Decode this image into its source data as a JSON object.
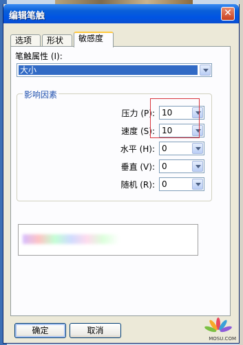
{
  "window": {
    "title": "编辑笔触"
  },
  "tabs": [
    {
      "label": "选项"
    },
    {
      "label": "形状"
    },
    {
      "label": "敏感度"
    }
  ],
  "panel": {
    "attribute_label": "笔触属性 (I):",
    "attribute_value": "大小",
    "group_title": "影响因素",
    "rows": [
      {
        "label": "压力 (P):",
        "value": "10"
      },
      {
        "label": "速度 (S):",
        "value": "10"
      },
      {
        "label": "水平 (H):",
        "value": "0"
      },
      {
        "label": "垂直 (V):",
        "value": "0"
      },
      {
        "label": "随机 (R):",
        "value": "0"
      }
    ]
  },
  "buttons": {
    "ok": "确定",
    "cancel": "取消"
  },
  "watermark": "MOSU.COM",
  "colors": {
    "titlebar": "#0054e3",
    "highlight": "#d8333b",
    "selection": "#316ac5"
  }
}
